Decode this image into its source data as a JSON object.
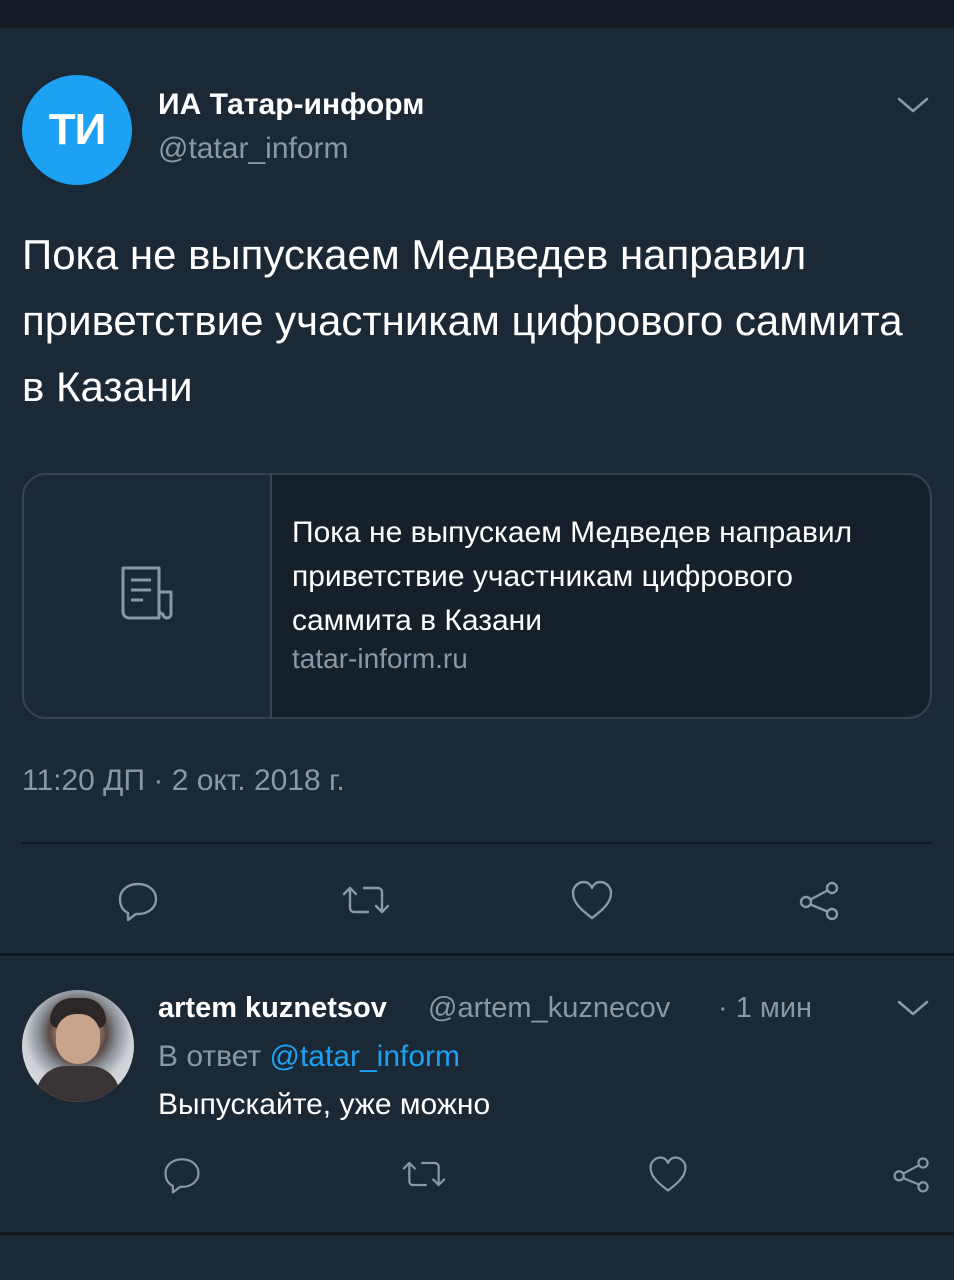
{
  "tweet": {
    "author_name": "ИА Татар-информ",
    "author_handle": "@tatar_inform",
    "avatar_initials": "ТИ",
    "text": "Пока не выпускаем Медведев направил приветствие участникам цифрового саммита в Казани",
    "card": {
      "title": "Пока не выпускаем Медведев направил приветствие участникам цифрового саммита в Казани",
      "domain": "tatar-inform.ru"
    },
    "timestamp": "11:20 ДП · 2 окт. 2018 г."
  },
  "reply": {
    "author_name": "artem kuznetsov",
    "author_handle": "@artem_kuznecov",
    "time": "· 1 мин",
    "reply_prefix": "В ответ",
    "reply_to": "@tatar_inform",
    "text": "Выпускайте, уже можно"
  },
  "colors": {
    "background": "#1b2836",
    "text_primary": "#ffffff",
    "text_muted": "#8899a6",
    "accent": "#1da1f2",
    "border": "#38444d"
  },
  "icons": [
    "chevron-down-icon",
    "document-icon",
    "reply-icon",
    "retweet-icon",
    "like-icon",
    "share-icon"
  ]
}
